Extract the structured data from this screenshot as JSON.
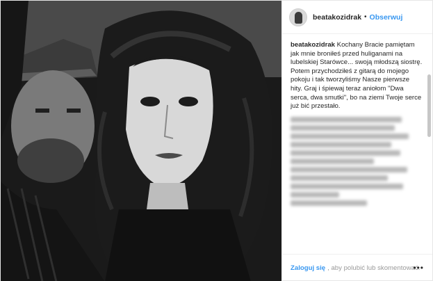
{
  "header": {
    "username": "beatakozidrak",
    "separator": "•",
    "follow_label": "Obserwuj"
  },
  "caption": {
    "username": "beatakozidrak",
    "text": "Kochany Bracie pamiętam jak mnie broniłeś przed huliganami na lubelskiej Starówce... swoją młodszą siostrę. Potem przychodziłeś z gitarą do mojego pokoju i tak tworzyliśmy Nasze pierwsze hity. Graj i śpiewaj teraz aniołom \"Dwa serca, dwa smutki\", bo na ziemi Twoje serce już bić przestało."
  },
  "footer": {
    "login_label": "Zaloguj się",
    "rest_text": ", aby polubić lub skomentować.",
    "more_icon": "•••"
  },
  "icons": {
    "avatar": "profile-avatar",
    "more": "ellipsis-icon"
  },
  "colors": {
    "link": "#3897f0",
    "text": "#262626",
    "muted": "#999999"
  }
}
